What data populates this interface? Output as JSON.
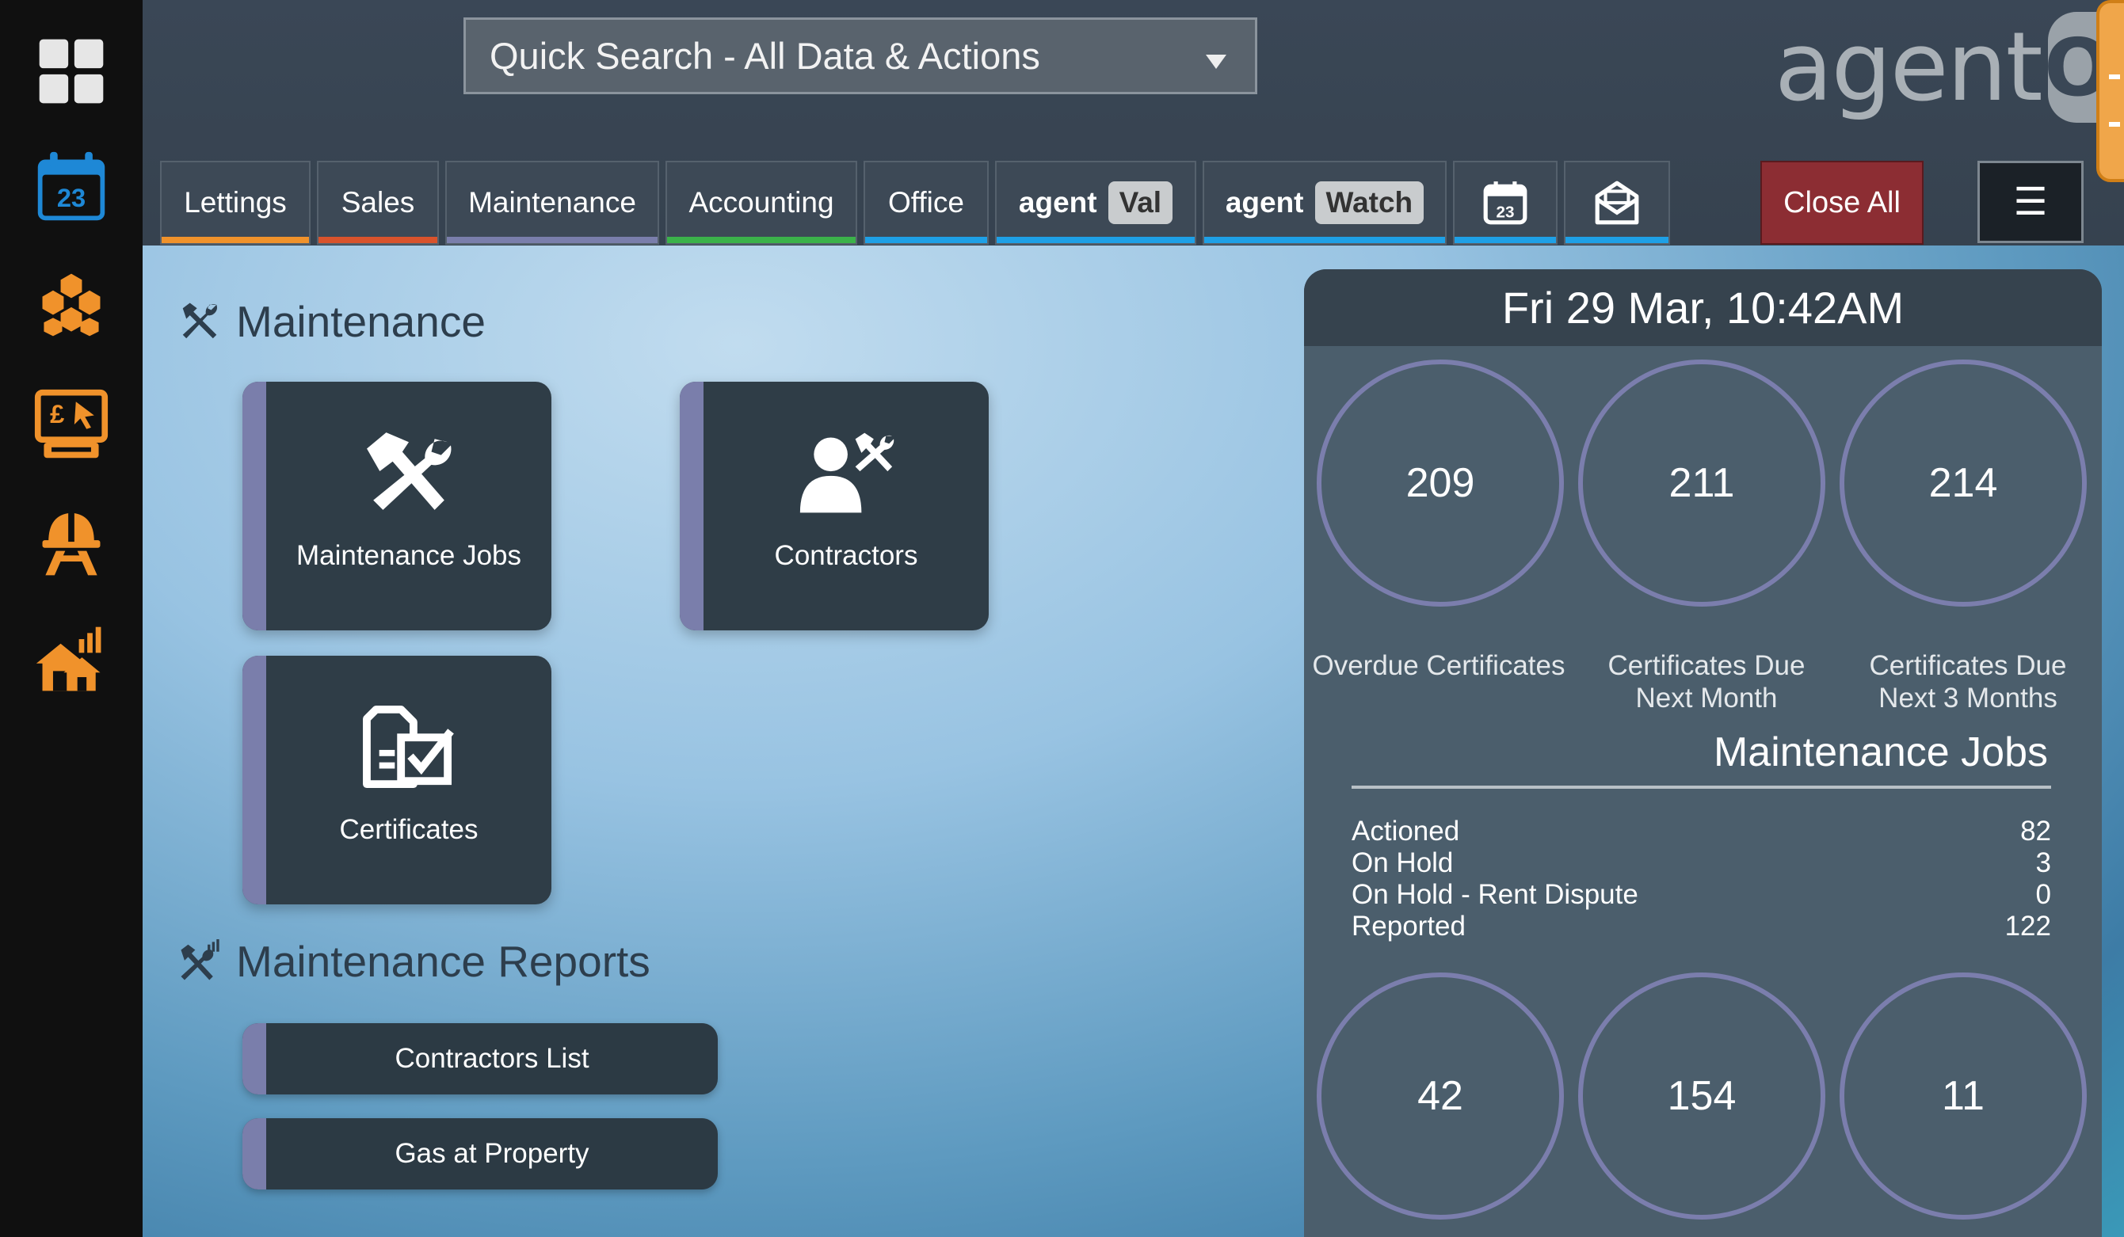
{
  "search": {
    "label": "Quick Search - All Data & Actions"
  },
  "logo": {
    "word": "agent",
    "os": "OS"
  },
  "rail": {
    "icons": [
      "dashboard-icon",
      "calendar-icon",
      "hexagon-icon",
      "finance-icon",
      "hard-hat-icon",
      "property-chart-icon"
    ],
    "calendar_day": "23"
  },
  "tabs": [
    {
      "label": "Lettings",
      "color": "#f0922b"
    },
    {
      "label": "Sales",
      "color": "#d9532c"
    },
    {
      "label": "Maintenance",
      "color": "#7a7eab"
    },
    {
      "label": "Accounting",
      "color": "#3bb24a"
    },
    {
      "label": "Office",
      "color": "#1ea0e6"
    },
    {
      "label": "agent",
      "pill": "Val",
      "color": "#1ea0e6"
    },
    {
      "label": "agent",
      "pill": "Watch",
      "color": "#1ea0e6"
    }
  ],
  "calendar_tab_day": "23",
  "close_all": "Close All",
  "menu_glyph": "☰",
  "maintenance": {
    "title": "Maintenance",
    "tiles": [
      "Maintenance Jobs",
      "Contractors",
      "Certificates"
    ]
  },
  "reports": {
    "title": "Maintenance Reports",
    "items": [
      "Contractors List",
      "Gas at Property"
    ]
  },
  "panel": {
    "datetime": "Fri 29 Mar, 10:42AM",
    "certificates": [
      {
        "value": "209",
        "label_1": "Overdue Certificates",
        "label_2": ""
      },
      {
        "value": "211",
        "label_1": "Certificates Due",
        "label_2": "Next Month"
      },
      {
        "value": "214",
        "label_1": "Certificates Due",
        "label_2": "Next 3 Months"
      }
    ],
    "jobs_title": "Maintenance Jobs",
    "jobs": [
      {
        "label": "Actioned",
        "value": "82"
      },
      {
        "label": "On Hold",
        "value": "3"
      },
      {
        "label": "On Hold - Rent Dispute",
        "value": "0"
      },
      {
        "label": "Reported",
        "value": "122"
      }
    ],
    "bottom_circles": [
      "42",
      "154",
      "11"
    ]
  },
  "colors": {
    "accent_maintenance": "#7a7eab",
    "rail_orange": "#f0922b",
    "rail_blue": "#1e88d6",
    "close_red": "#8c2d33"
  }
}
